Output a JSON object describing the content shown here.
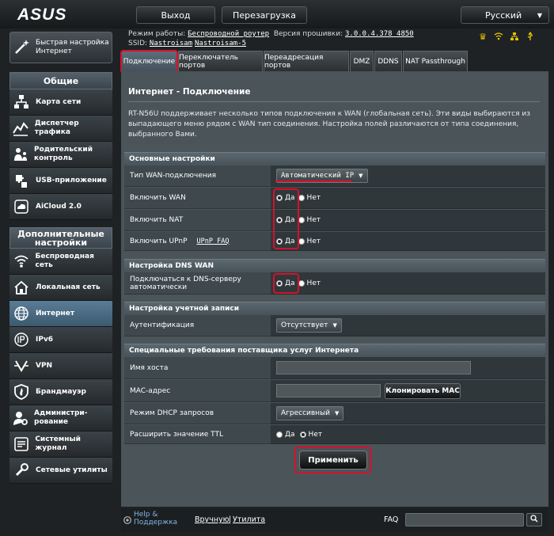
{
  "header": {
    "logo": "ASUS",
    "logout_label": "Выход",
    "reboot_label": "Перезагрузка",
    "language": "Русский"
  },
  "status": {
    "mode_label": "Режим работы:",
    "mode_value": "Беспроводной роутер",
    "firmware_label": "Версия прошивки:",
    "firmware_value": "3.0.0.4.378_4850",
    "ssid_label": "SSID:",
    "ssid_1": "Nastroisam",
    "ssid_2": "Nastroisam-5"
  },
  "sidebar": {
    "quick_setup": "Быстрая настройка Интернет",
    "general_header": "Общие",
    "general_items": [
      {
        "label": "Карта сети",
        "icon": "network-map-icon"
      },
      {
        "label": "Диспетчер трафика",
        "icon": "traffic-manager-icon"
      },
      {
        "label": "Родительский контроль",
        "icon": "parental-control-icon"
      },
      {
        "label": "USB-приложение",
        "icon": "usb-app-icon"
      },
      {
        "label": "AiCloud 2.0",
        "icon": "aicloud-icon"
      }
    ],
    "advanced_header": "Дополнительные настройки",
    "advanced_items": [
      {
        "label": "Беспроводная сеть",
        "icon": "wireless-icon"
      },
      {
        "label": "Локальная сеть",
        "icon": "lan-icon"
      },
      {
        "label": "Интернет",
        "icon": "globe-icon"
      },
      {
        "label": "IPv6",
        "icon": "ipv6-icon"
      },
      {
        "label": "VPN",
        "icon": "vpn-icon"
      },
      {
        "label": "Брандмауэр",
        "icon": "firewall-icon"
      },
      {
        "label": "Администри-рование",
        "icon": "admin-icon"
      },
      {
        "label": "Системный журнал",
        "icon": "syslog-icon"
      },
      {
        "label": "Сетевые утилиты",
        "icon": "network-tools-icon"
      }
    ]
  },
  "tabs": [
    {
      "label": "Подключение",
      "active": true
    },
    {
      "label": "Переключатель портов"
    },
    {
      "label": "Переадресация портов"
    },
    {
      "label": "DMZ"
    },
    {
      "label": "DDNS"
    },
    {
      "label": "NAT Passthrough"
    }
  ],
  "page": {
    "title": "Интернет - Подключение",
    "description": "RT-N56U поддерживает несколько типов подключения к WAN (глобальная сеть). Эти виды выбираются из выпадающего меню рядом с WAN тип соединения. Настройка полей различаются от типа соединения, выбранного Вами."
  },
  "basic": {
    "header": "Основные настройки",
    "wan_type_label": "Тип WAN-подключения",
    "wan_type_value": "Автоматический IP",
    "enable_wan_label": "Включить WAN",
    "enable_nat_label": "Включить NAT",
    "enable_upnp_label": "Включить UPnP",
    "upnp_faq": "UPnP  FAQ",
    "yes": "Да",
    "no": "Нет"
  },
  "dns": {
    "header": "Настройка DNS WAN",
    "auto_label": "Подключаться к DNS-серверу автоматически"
  },
  "account": {
    "header": "Настройка учетной записи",
    "auth_label": "Аутентификация",
    "auth_value": "Отсутствует"
  },
  "isp": {
    "header": "Специальные требования поставщика услуг Интернета",
    "hostname_label": "Имя хоста",
    "hostname_value": "",
    "mac_label": "MAC-адрес",
    "mac_value": "",
    "clone_mac": "Клонировать MAC",
    "dhcp_label": "Режим DHCP запросов",
    "dhcp_value": "Агрессивный",
    "ttl_label": "Расширить значение TTL"
  },
  "apply_label": "Применить",
  "footer": {
    "help": "Help & Поддержка",
    "manual": "Вручную",
    "separator": "|",
    "utility": "Утилита",
    "faq": "FAQ"
  },
  "colors": {
    "highlight": "#d8102a",
    "panel": "#4a5459",
    "background": "#1f2224"
  }
}
